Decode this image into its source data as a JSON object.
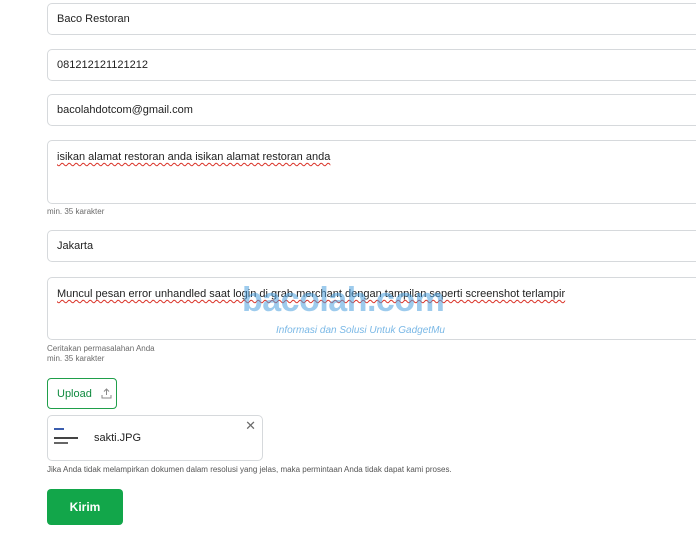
{
  "form": {
    "restaurant_name": "Baco Restoran",
    "phone": "081212121121212",
    "email": "bacolahdotcom@gmail.com",
    "address": {
      "value": "isikan alamat restoran anda isikan alamat restoran anda",
      "hint": "min. 35 karakter"
    },
    "city": "Jakarta",
    "problem": {
      "value": "Muncul pesan error  unhandled  saat login di grab merchant dengan tampilan seperti screenshot terlampir",
      "hint_label": "Ceritakan permasalahan Anda",
      "hint_min": "min. 35 karakter"
    },
    "upload": {
      "label": "Upload",
      "icon": "upload-icon"
    },
    "attachment": {
      "file_name": "sakti.JPG",
      "close_icon": "close-icon"
    },
    "notice": "Jika Anda tidak melampirkan dokumen dalam resolusi yang jelas, maka permintaan Anda tidak dapat kami proses.",
    "submit_label": "Kirim"
  },
  "watermark": {
    "brand": "bacolah.com",
    "tagline": "Informasi dan Solusi Untuk GadgetMu"
  },
  "colors": {
    "accent": "#12a64a",
    "border": "#d6d9dc",
    "spellcheck": "#d93025"
  }
}
